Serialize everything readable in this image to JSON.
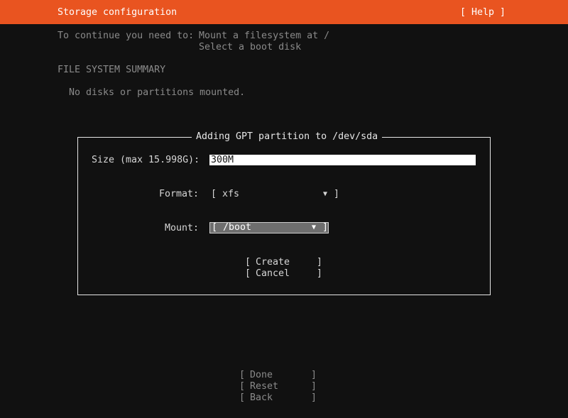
{
  "header": {
    "title": "Storage configuration",
    "help": "[ Help ]"
  },
  "intro": {
    "lead": "To continue you need to:",
    "line1": "Mount a filesystem at /",
    "line2": "Select a boot disk"
  },
  "summary": {
    "heading": "FILE SYSTEM SUMMARY",
    "empty": "No disks or partitions mounted."
  },
  "dialog": {
    "title": "Adding GPT partition to /dev/sda",
    "size_label": "Size (max 15.998G):",
    "size_value": "300M",
    "format_label": "Format:",
    "format_open": "[",
    "format_value": "xfs",
    "format_arrow": "▼",
    "format_close": "]",
    "mount_label": "Mount:",
    "mount_open": "[",
    "mount_value": "/boot",
    "mount_arrow": "▼",
    "mount_close": "]",
    "create_open": "[",
    "create_label": "Create",
    "create_close": "]",
    "cancel_open": "[",
    "cancel_label": "Cancel",
    "cancel_close": "]"
  },
  "footer": {
    "done_open": "[",
    "done_label": "Done",
    "done_close": "]",
    "reset_open": "[",
    "reset_label": "Reset",
    "reset_close": "]",
    "back_open": "[",
    "back_label": "Back",
    "back_close": "]"
  },
  "colors": {
    "header_bg": "#e95420",
    "background": "#111111"
  }
}
